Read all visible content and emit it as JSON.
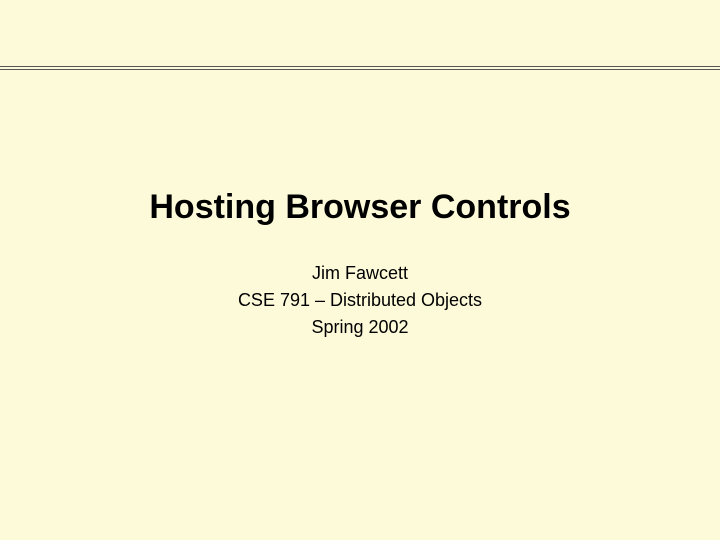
{
  "slide": {
    "title": "Hosting Browser Controls",
    "author": "Jim Fawcett",
    "course": "CSE 791 – Distributed Objects",
    "term": "Spring 2002"
  }
}
